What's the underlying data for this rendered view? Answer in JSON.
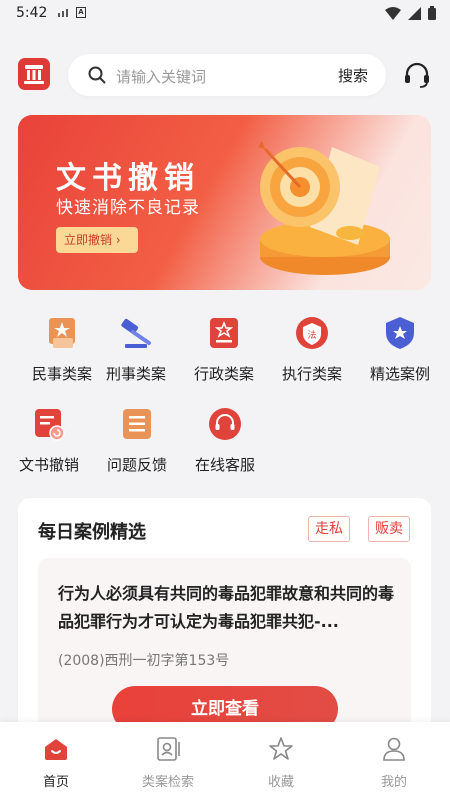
{
  "status": {
    "time": "5:42"
  },
  "header": {
    "search_placeholder": "请输入关键词",
    "search_button": "搜索"
  },
  "banner": {
    "title": "文书撤销",
    "subtitle": "快速消除不良记录",
    "button": "立即撤销 ›"
  },
  "menu": [
    {
      "label": "民事类案",
      "icon": "civil-case-icon"
    },
    {
      "label": "刑事类案",
      "icon": "criminal-case-gavel-icon"
    },
    {
      "label": "行政类案",
      "icon": "administrative-case-icon"
    },
    {
      "label": "执行类案",
      "icon": "enforcement-case-icon"
    },
    {
      "label": "精选案例",
      "icon": "featured-case-shield-icon"
    },
    {
      "label": "文书撤销",
      "icon": "document-revoke-icon"
    },
    {
      "label": "问题反馈",
      "icon": "feedback-icon"
    },
    {
      "label": "在线客服",
      "icon": "online-service-icon"
    }
  ],
  "daily": {
    "title": "每日案例精选",
    "tags": [
      "走私",
      "贩卖"
    ],
    "case_title": "行为人必须具有共同的毒品犯罪故意和共同的毒品犯罪行为才可认定为毒品犯罪共犯-...",
    "case_number": "(2008)西刑一初字第153号",
    "view_button": "立即查看"
  },
  "tabs": [
    {
      "label": "首页",
      "active": true
    },
    {
      "label": "类案检索",
      "active": false
    },
    {
      "label": "收藏",
      "active": false
    },
    {
      "label": "我的",
      "active": false
    }
  ],
  "colors": {
    "accent": "#e0433a",
    "icon_blue": "#4a5fd4",
    "icon_orange": "#e99559"
  }
}
